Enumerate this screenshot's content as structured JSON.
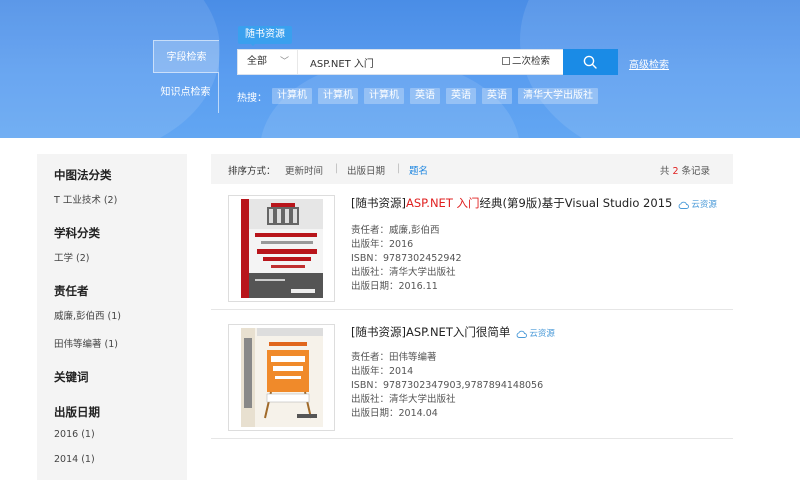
{
  "header": {
    "side_tabs": [
      "字段检索",
      "知识点检索"
    ],
    "scope_tag": "随书资源",
    "search": {
      "scope_selected": "全部",
      "query": "ASP.NET 入门",
      "second_search_label": "二次检索"
    },
    "advanced_search_label": "高级检索",
    "hot": {
      "label": "热搜：",
      "tags": [
        "计算机",
        "计算机",
        "计算机",
        "英语",
        "英语",
        "英语",
        "清华大学出版社"
      ]
    }
  },
  "facets": [
    {
      "title": "中图法分类",
      "items": [
        "T 工业技术 (2)"
      ]
    },
    {
      "title": "学科分类",
      "items": [
        "工学 (2)"
      ]
    },
    {
      "title": "责任者",
      "items": [
        "威廉,彭伯西 (1)",
        "田伟等编著 (1)"
      ]
    },
    {
      "title": "关键词",
      "items": []
    },
    {
      "title": "出版日期",
      "items": [
        "2016 (1)",
        "2014 (1)"
      ]
    }
  ],
  "sort": {
    "label": "排序方式：",
    "options": [
      "更新时间",
      "出版日期",
      "题名"
    ],
    "active": "题名",
    "total_prefix": "共",
    "total_count": "2",
    "total_suffix": "条记录"
  },
  "results": [
    {
      "title_prefix": "[随书资源]",
      "title_highlight": "ASP.NET 入门",
      "title_rest": "经典(第9版)基于Visual Studio 2015",
      "cloud_label": "云资源",
      "author": "责任者：威廉,彭伯西",
      "year": "出版年：2016",
      "isbn": "ISBN：9787302452942",
      "publisher": "出版社：清华大学出版社",
      "pubdate": "出版日期：2016.11"
    },
    {
      "title_prefix": "[随书资源]",
      "title_highlight": "",
      "title_rest": "ASP.NET入门很简单",
      "cloud_label": "云资源",
      "author": "责任者：田伟等编著",
      "year": "出版年：2014",
      "isbn": "ISBN：9787302347903,9787894148056",
      "publisher": "出版社：清华大学出版社",
      "pubdate": "出版日期：2014.04"
    }
  ],
  "colors": {
    "header_blue": "#5a9df0",
    "search_button": "#1a8be6",
    "highlight_red": "#e02020",
    "link_blue": "#1e86e0"
  }
}
